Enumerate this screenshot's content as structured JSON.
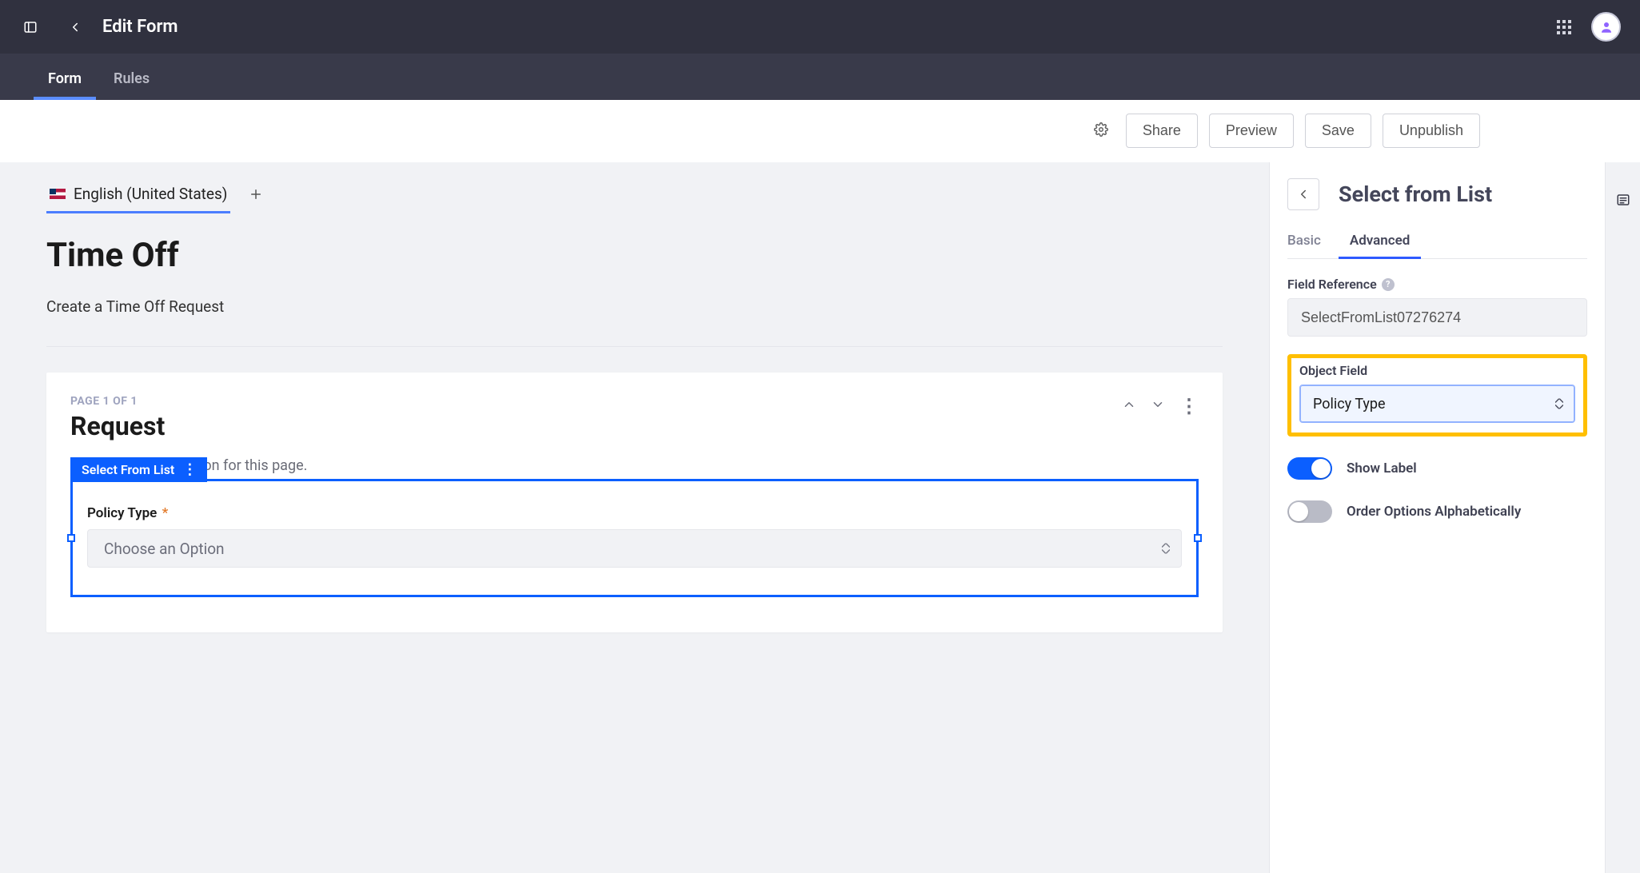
{
  "topbar": {
    "title": "Edit Form"
  },
  "tabs": [
    {
      "label": "Form",
      "active": true
    },
    {
      "label": "Rules",
      "active": false
    }
  ],
  "actions": {
    "share": "Share",
    "preview": "Preview",
    "save": "Save",
    "unpublish": "Unpublish"
  },
  "language_tab": "English (United States)",
  "form": {
    "title": "Time Off",
    "description": "Create a Time Off Request"
  },
  "page": {
    "meta": "PAGE 1 OF 1",
    "title": "Request",
    "description": "Add a short description for this page."
  },
  "field_chip": "Select From List",
  "field": {
    "label": "Policy Type",
    "required_mark": "*",
    "placeholder": "Choose an Option"
  },
  "side": {
    "title": "Select from List",
    "tabs": {
      "basic": "Basic",
      "advanced": "Advanced"
    },
    "field_reference_label": "Field Reference",
    "field_reference_value": "SelectFromList07276274",
    "object_field_label": "Object Field",
    "object_field_value": "Policy Type",
    "show_label": "Show Label",
    "order_alpha": "Order Options Alphabetically"
  }
}
